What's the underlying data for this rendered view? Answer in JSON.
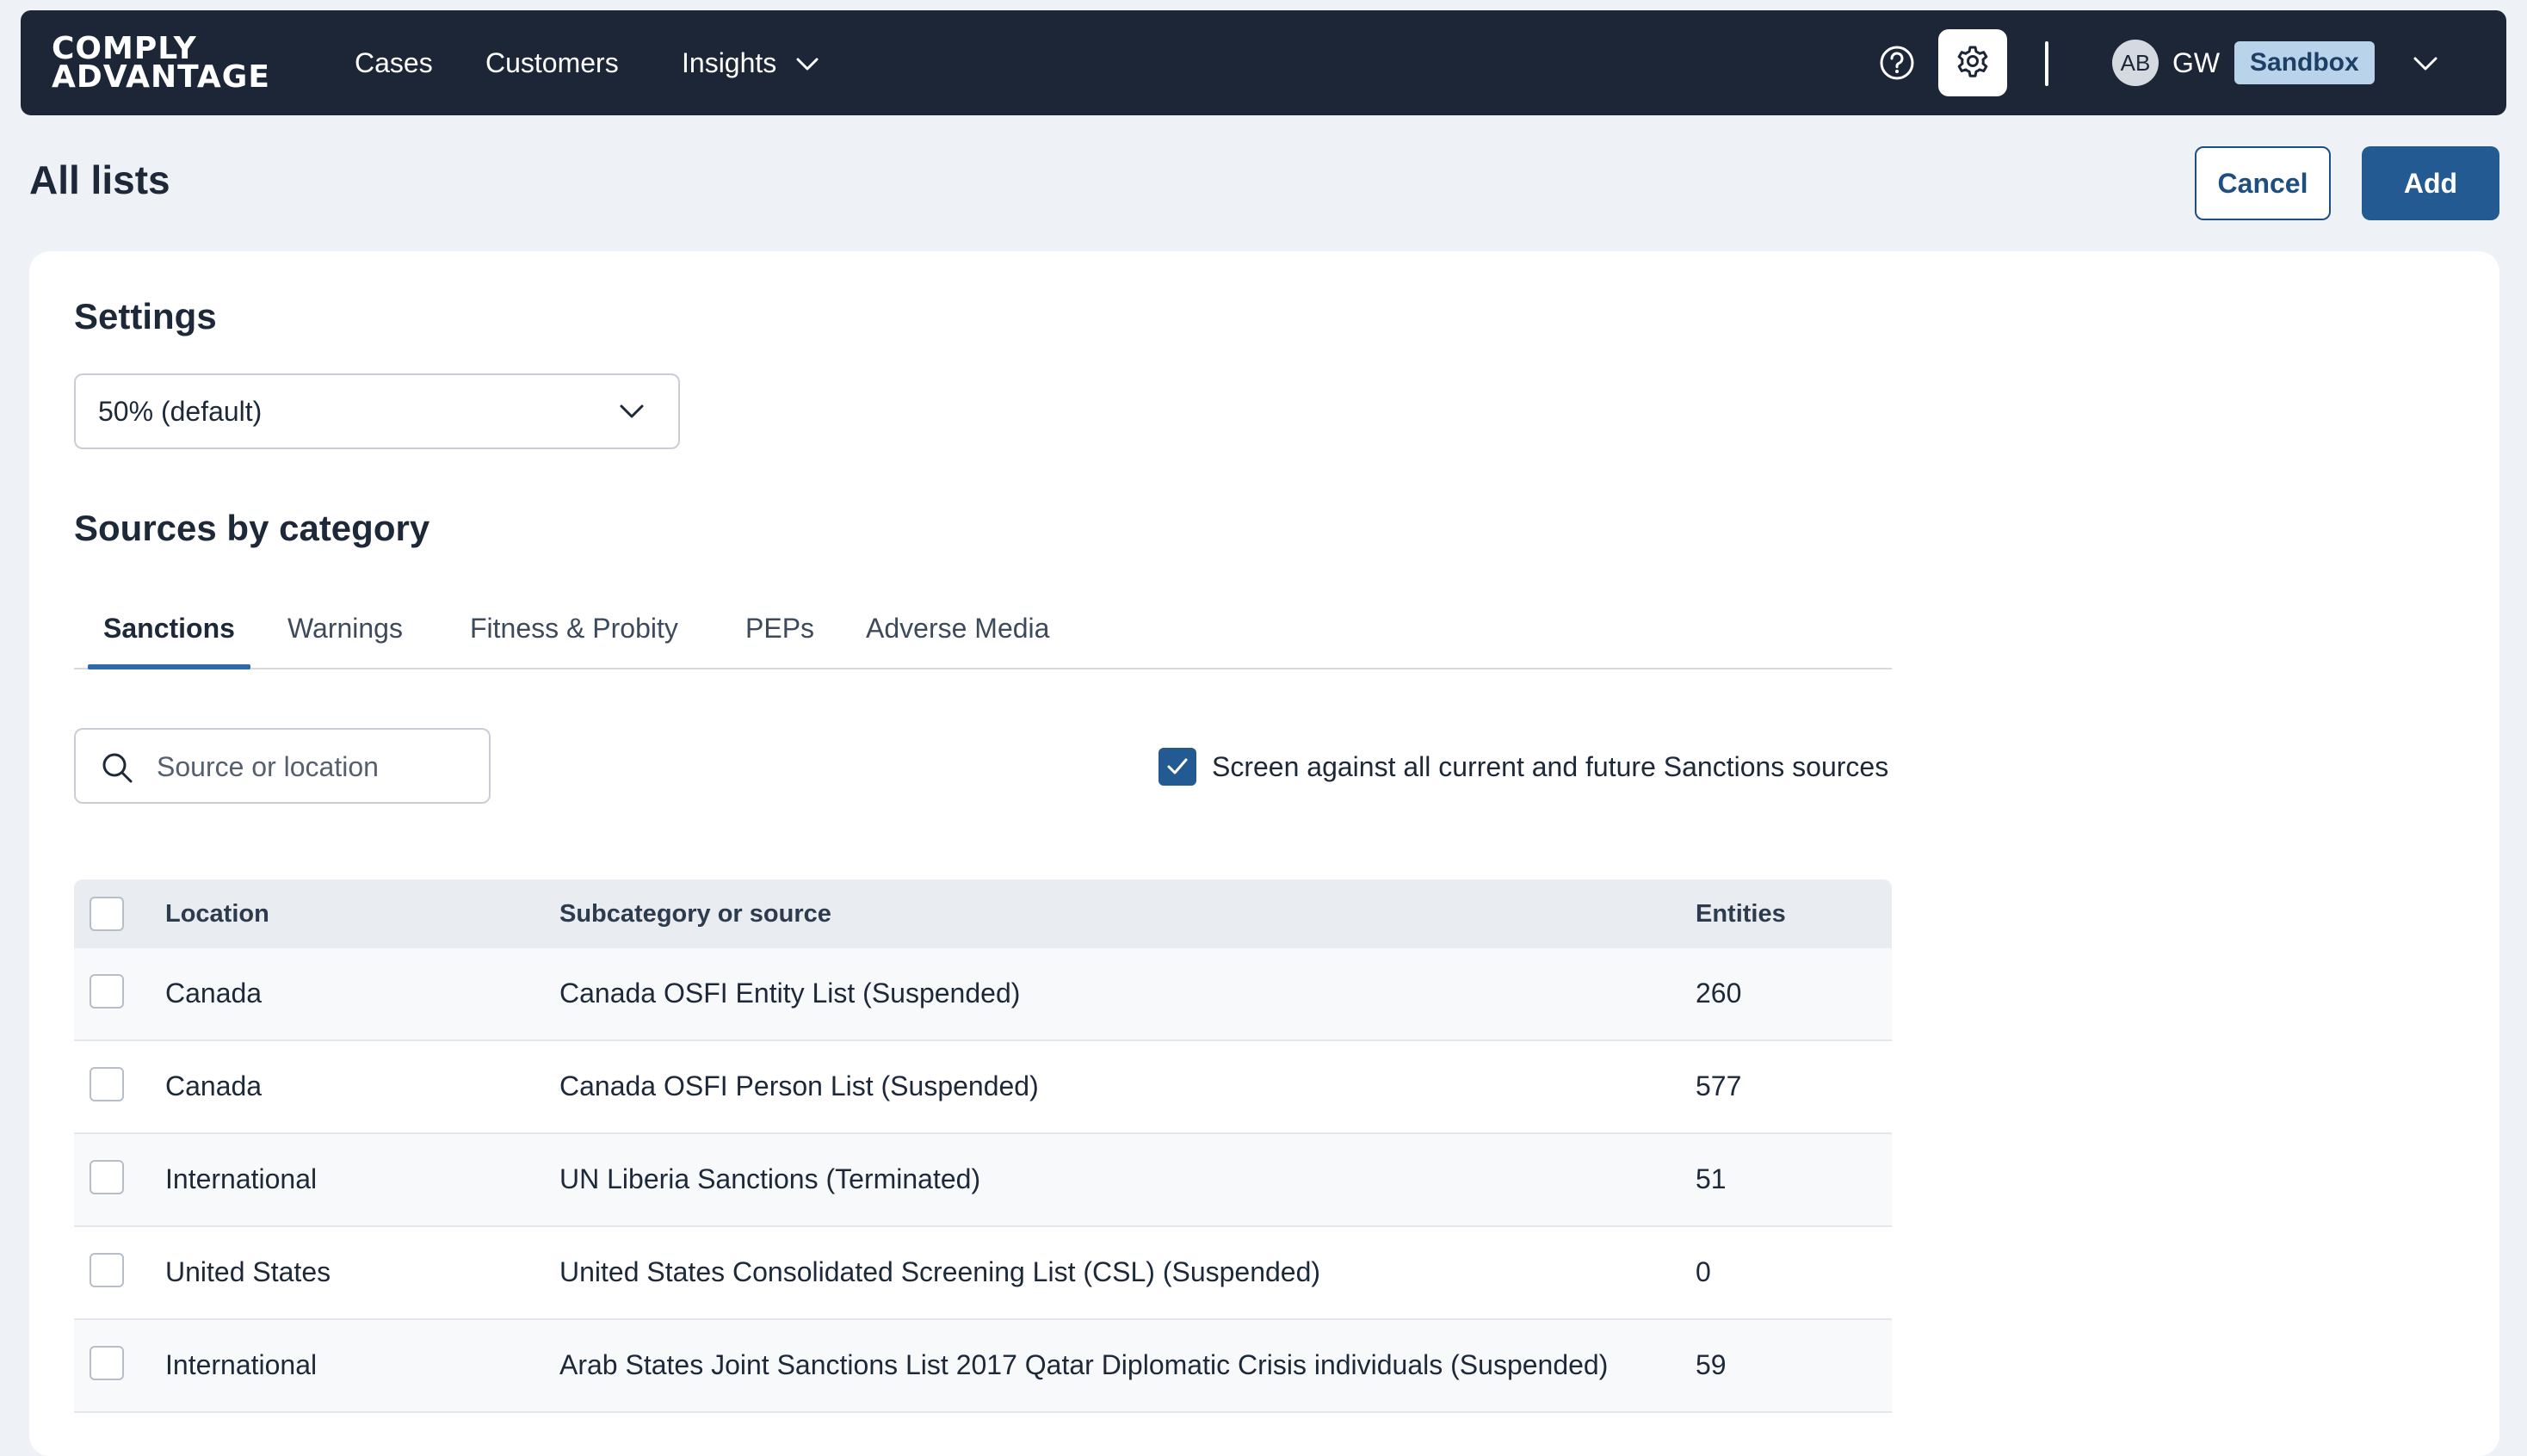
{
  "brand": {
    "line1": "COMPLY",
    "line2": "ADVANTAGE"
  },
  "nav": {
    "items": [
      {
        "label": "Cases"
      },
      {
        "label": "Customers"
      },
      {
        "label": "Insights",
        "has_dropdown": true
      }
    ],
    "icons": [
      "help-circle-icon",
      "gear-icon",
      "chevron-down-icon"
    ],
    "user": {
      "avatar_initials": "AB",
      "initials": "GW",
      "environment": "Sandbox"
    }
  },
  "page": {
    "title": "All lists",
    "cancel_label": "Cancel",
    "add_label": "Add"
  },
  "settings": {
    "title": "Settings",
    "threshold_value": "50% (default)"
  },
  "sources": {
    "title": "Sources by category",
    "tabs": [
      {
        "label": "Sanctions",
        "active": true
      },
      {
        "label": "Warnings"
      },
      {
        "label": "Fitness & Probity"
      },
      {
        "label": "PEPs"
      },
      {
        "label": "Adverse Media"
      }
    ],
    "search_placeholder": "Source or location",
    "screen_all": {
      "label": "Screen against all current and future Sanctions sources",
      "checked": true
    },
    "table": {
      "headers": {
        "location": "Location",
        "source": "Subcategory or source",
        "entities": "Entities"
      },
      "rows": [
        {
          "location": "Canada",
          "source": "Canada OSFI Entity List (Suspended)",
          "entities": "260"
        },
        {
          "location": "Canada",
          "source": "Canada OSFI Person List (Suspended)",
          "entities": "577"
        },
        {
          "location": "International",
          "source": "UN Liberia Sanctions (Terminated)",
          "entities": "51"
        },
        {
          "location": "United States",
          "source": "United States Consolidated Screening List (CSL) (Suspended)",
          "entities": "0"
        },
        {
          "location": "International",
          "source": "Arab States Joint Sanctions List 2017 Qatar Diplomatic Crisis individuals (Suspended)",
          "entities": "59"
        }
      ]
    }
  },
  "colors": {
    "nav_bg": "#1d2636",
    "primary": "#245a92",
    "badge_bg": "#b9d4ea",
    "tab_active": "#2f6aa8",
    "page_bg": "#eef2f7"
  }
}
